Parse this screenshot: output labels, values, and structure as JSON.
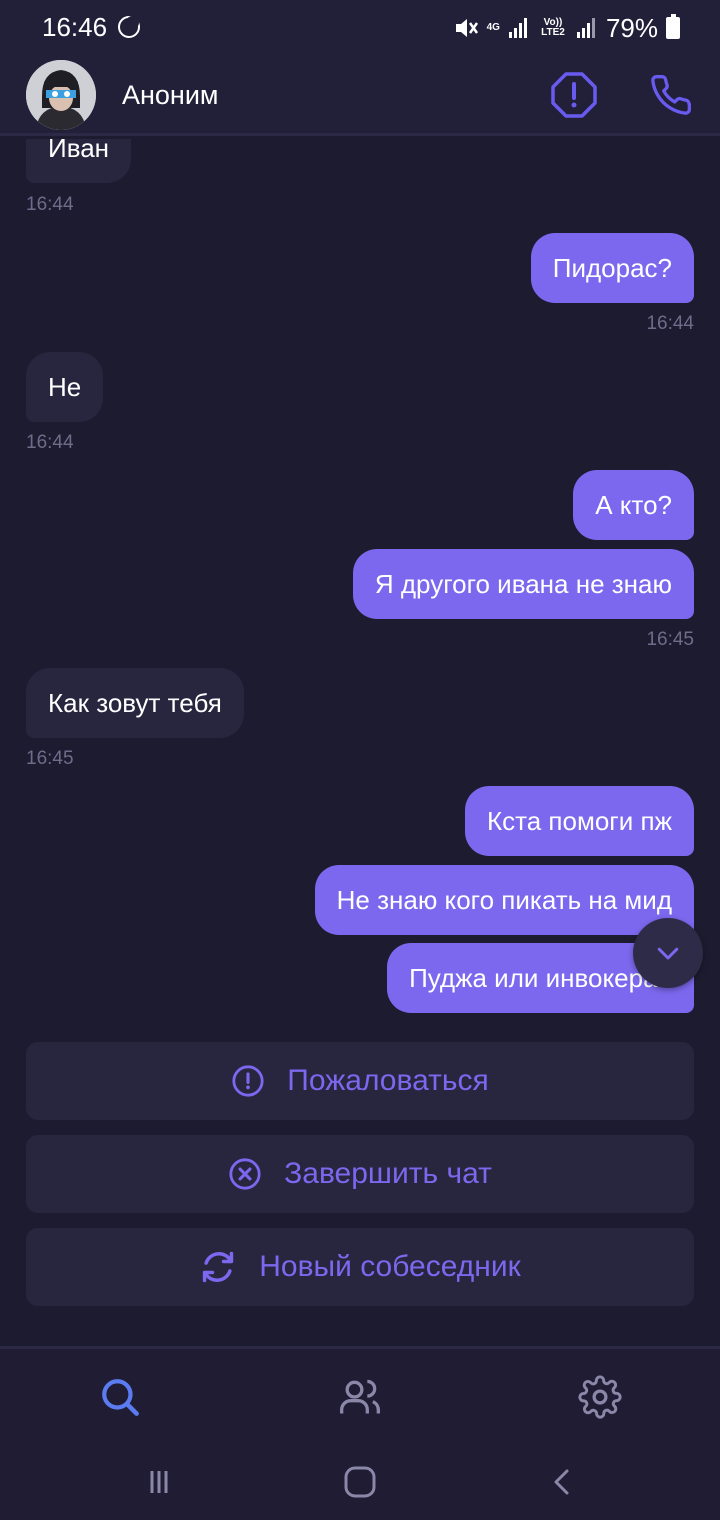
{
  "status_bar": {
    "time": "16:46",
    "network_top": "4G",
    "volte": "Vo)) LTE2",
    "battery": "79%"
  },
  "header": {
    "contact_name": "Аноним",
    "icons": [
      "avatar",
      "report-icon",
      "phone-icon"
    ]
  },
  "messages": [
    {
      "side": "in",
      "text": "Иван"
    },
    {
      "side": "in",
      "time": "16:44"
    },
    {
      "side": "out",
      "text": "Пидорас?"
    },
    {
      "side": "out",
      "time": "16:44"
    },
    {
      "side": "in",
      "text": "Не"
    },
    {
      "side": "in",
      "time": "16:44"
    },
    {
      "side": "out",
      "text": "А кто?"
    },
    {
      "side": "out",
      "text": "Я другого ивана не знаю"
    },
    {
      "side": "out",
      "time": "16:45"
    },
    {
      "side": "in",
      "text": "Как зовут тебя"
    },
    {
      "side": "in",
      "time": "16:45"
    },
    {
      "side": "out",
      "text": "Кста помоги пж"
    },
    {
      "side": "out",
      "text": "Не знаю кого пикать на мид"
    },
    {
      "side": "out",
      "text": "Пуджа или инвокера?"
    }
  ],
  "actions": {
    "report": "Пожаловаться",
    "end_chat": "Завершить чат",
    "new_partner": "Новый собеседник"
  },
  "bottom_nav": [
    "search-icon",
    "people-icon",
    "gear-icon"
  ],
  "colors": {
    "background": "#1d1b30",
    "bubble_in": "#28253f",
    "bubble_out": "#7b68ee",
    "accent": "#7b68ee",
    "active_nav": "#5b7cf0"
  }
}
